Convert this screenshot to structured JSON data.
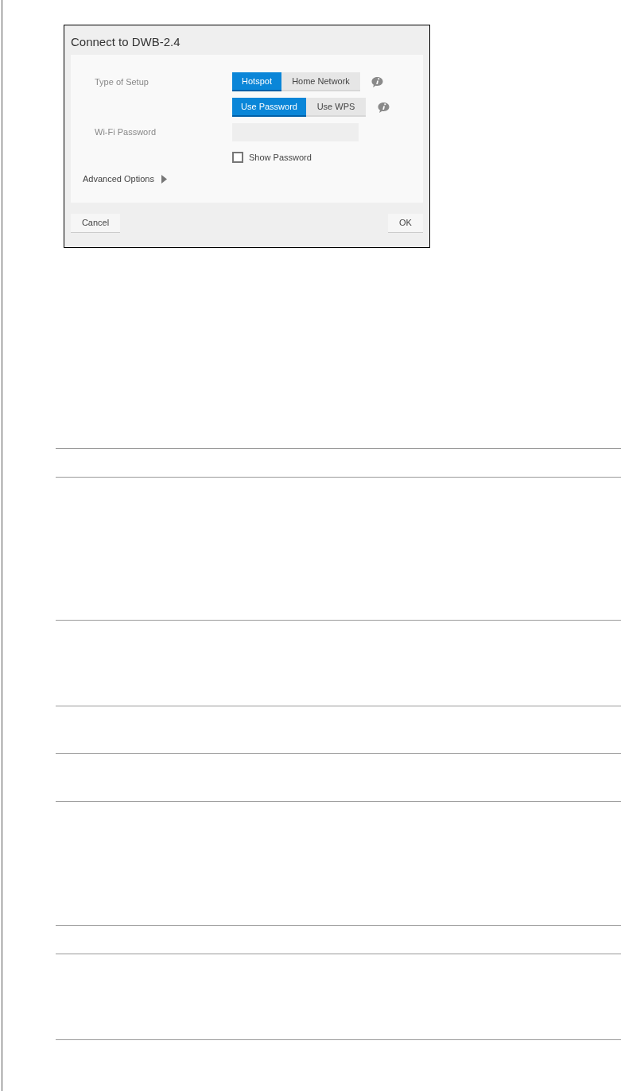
{
  "dialog": {
    "title": "Connect to DWB-2.4",
    "setup_type": {
      "label": "Type of Setup",
      "segments": [
        {
          "label": "Hotspot",
          "selected": true
        },
        {
          "label": "Home Network",
          "selected": false
        }
      ]
    },
    "security": {
      "segments": [
        {
          "label": "Use Password",
          "selected": true
        },
        {
          "label": "Use WPS",
          "selected": false
        }
      ]
    },
    "password": {
      "label": "Wi-Fi Password"
    },
    "show_password": {
      "label": "Show Password",
      "checked": false
    },
    "advanced_options": {
      "label": "Advanced Options",
      "expanded": false
    },
    "buttons": [
      {
        "label": "Cancel",
        "kind": "secondary"
      },
      {
        "label": "OK",
        "kind": "primary"
      }
    ]
  }
}
